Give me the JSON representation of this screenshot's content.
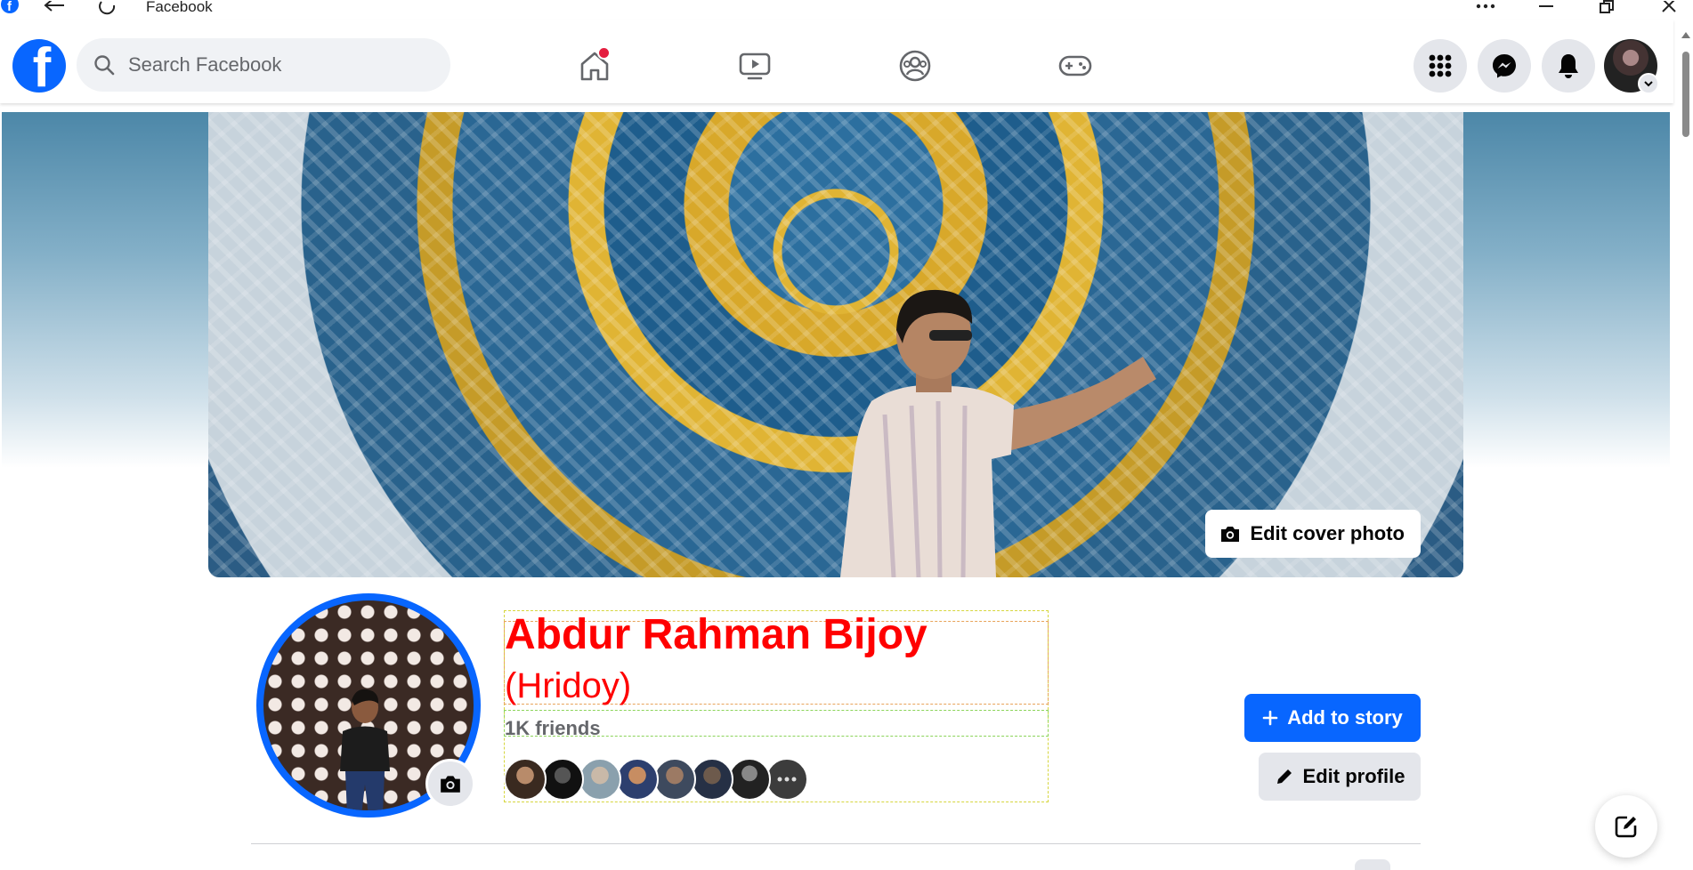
{
  "window": {
    "title": "Facebook",
    "icons": [
      "facebook-icon",
      "back-arrow-icon",
      "refresh-icon",
      "more-icon",
      "minimize-icon",
      "restore-icon",
      "close-icon"
    ]
  },
  "header": {
    "search_placeholder": "Search Facebook",
    "nav": [
      "home-icon",
      "watch-icon",
      "groups-icon",
      "gaming-icon"
    ],
    "home_notification": true,
    "right_buttons": [
      "menu-grid-icon",
      "messenger-icon",
      "notifications-bell-icon",
      "account-avatar"
    ]
  },
  "cover": {
    "edit_cover_label": "Edit cover photo"
  },
  "profile": {
    "name": "Abdur Rahman Bijoy",
    "nickname": "(Hridoy)",
    "friends_label": "1K friends",
    "friend_avatar_count": 8,
    "add_story_label": "Add to story",
    "edit_profile_label": "Edit profile"
  },
  "colors": {
    "brand": "#0866ff",
    "name_color": "#ff0000",
    "button_gray": "#e4e6eb",
    "notification_dot": "#e41e3f"
  }
}
